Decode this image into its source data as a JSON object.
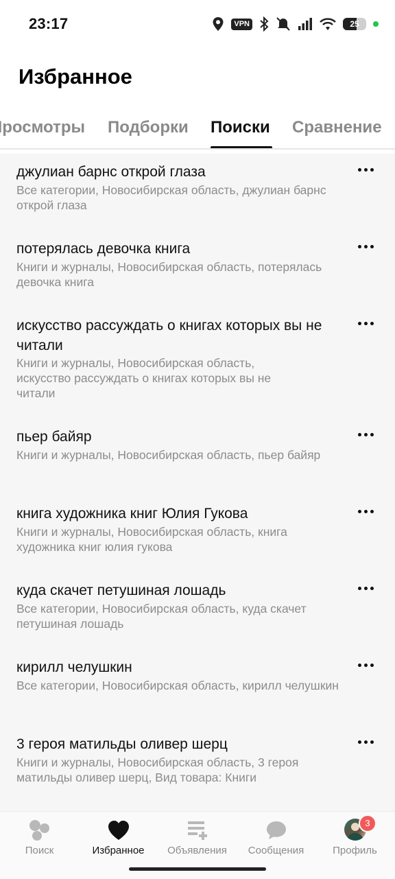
{
  "status_bar": {
    "time": "23:17",
    "vpn_label": "VPN",
    "battery_level": "25",
    "icons": [
      "location-icon",
      "vpn-icon",
      "bluetooth-icon",
      "mute-icon",
      "signal-icon",
      "wifi-icon",
      "battery-icon"
    ]
  },
  "header": {
    "title": "Избранное"
  },
  "tabs": [
    {
      "label": "Просмотры",
      "active": false
    },
    {
      "label": "Подборки",
      "active": false
    },
    {
      "label": "Поиски",
      "active": true
    },
    {
      "label": "Сравнение",
      "active": false
    }
  ],
  "searches": [
    {
      "title": "джулиан барнс открой глаза",
      "subtitle": "Все категории, Новосибирская область, джулиан барнс открой глаза"
    },
    {
      "title": "потерялась девочка книга",
      "subtitle": "Книги и журналы, Новосибирская область, потерялась девочка книга"
    },
    {
      "title": "искусство рассуждать о книгах которых вы не читали",
      "subtitle": "Книги и журналы, Новосибирская область, искусство рассуждать о книгах которых вы не читали"
    },
    {
      "title": "пьер байяр",
      "subtitle": "Книги и журналы, Новосибирская область, пьер байяр"
    },
    {
      "title": "книга художника книг Юлия Гукова",
      "subtitle": "Книги и журналы, Новосибирская область, книга художника книг юлия гукова"
    },
    {
      "title": "куда скачет петушиная лошадь",
      "subtitle": "Все категории, Новосибирская область, куда скачет петушиная лошадь"
    },
    {
      "title": "кирилл челушкин",
      "subtitle": "Все категории, Новосибирская область, кирилл челушкин"
    },
    {
      "title": "3 героя матильды оливер шерц",
      "subtitle": "Книги и журналы, Новосибирская область, 3 героя матильды оливер шерц, Вид товара: Книги"
    }
  ],
  "bottom_nav": {
    "items": [
      {
        "label": "Поиск",
        "icon": "search-bubbles-icon",
        "active": false
      },
      {
        "label": "Избранное",
        "icon": "heart-icon",
        "active": true
      },
      {
        "label": "Объявления",
        "icon": "listings-add-icon",
        "active": false
      },
      {
        "label": "Сообщения",
        "icon": "chat-icon",
        "active": false
      },
      {
        "label": "Профиль",
        "icon": "avatar",
        "active": false,
        "badge": "3"
      }
    ]
  },
  "colors": {
    "accent": "#111111",
    "muted": "#8a8a8a",
    "list_bg": "#f6f6f6",
    "badge": "#f25a5a"
  }
}
